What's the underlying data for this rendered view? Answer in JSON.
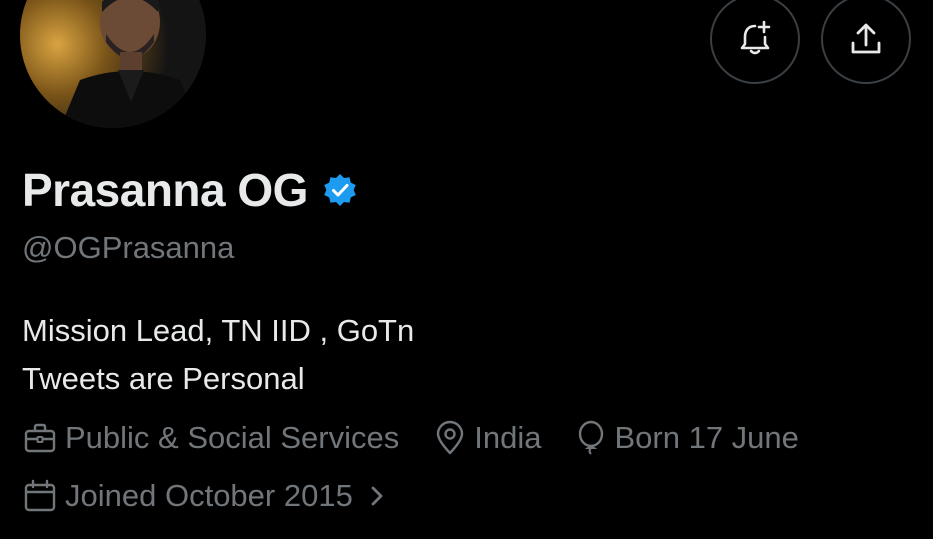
{
  "profile": {
    "display_name": "Prasanna OG",
    "handle": "@OGPrasanna",
    "verified": true,
    "verified_color": "#1d9bf0",
    "bio_lines": [
      "Mission Lead, TN IID , GoTn",
      "Tweets are Personal"
    ],
    "category": "Public & Social Services",
    "location": "India",
    "birthday": "Born 17 June",
    "joined": "Joined October 2015"
  },
  "actions": {
    "notify_icon": "bell-plus-icon",
    "share_icon": "share-icon"
  },
  "icons": {
    "category": "briefcase-icon",
    "location": "location-pin-icon",
    "birthday": "balloon-icon",
    "joined": "calendar-icon",
    "joined_more": "chevron-right-icon"
  },
  "colors": {
    "background": "#000000",
    "primary_text": "#e7e9ea",
    "secondary_text": "#71767b",
    "button_border": "#3a3f44"
  }
}
